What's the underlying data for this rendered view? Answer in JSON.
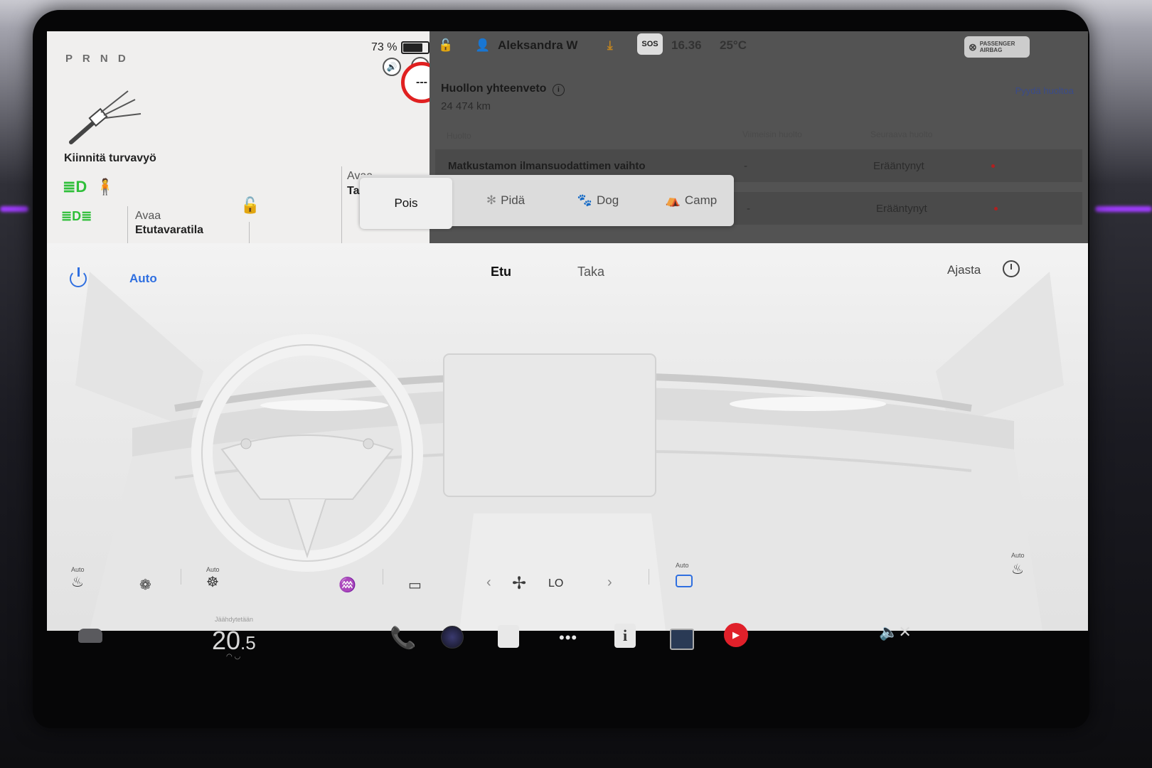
{
  "drive": {
    "gears": "P R N D",
    "battery_percent": "73 %",
    "battery_level": 0.73,
    "speed_limit": "---",
    "seatbelt_warning": "Kiinnitä turvavyö",
    "frunk": {
      "line1": "Avaa",
      "line2": "Etutavaratila"
    },
    "trunk": {
      "line1": "Avaa",
      "line2": "Ta"
    }
  },
  "status": {
    "user": "Aleksandra W",
    "sos": "SOS",
    "time": "16.36",
    "outside_temp": "25°C",
    "airbag": "PASSENGER AIRBAG"
  },
  "service": {
    "title": "Huollon yhteenveto",
    "odometer": "24 474 km",
    "link": "Pyydä huoltoa",
    "columns": [
      "Huolto",
      "Viimeisin huolto",
      "Seuraava huolto"
    ],
    "rows": [
      {
        "name": "Matkustamon ilmansuodattimen vaihto",
        "last": "-",
        "next": "Erääntynyt"
      },
      {
        "name": "",
        "last": "-",
        "next": "Erääntynyt"
      }
    ]
  },
  "modes": [
    {
      "label": "Pois",
      "active": true
    },
    {
      "label": "Pidä",
      "active": false
    },
    {
      "label": "Dog",
      "active": false
    },
    {
      "label": "Camp",
      "active": false
    }
  ],
  "climate": {
    "auto": "Auto",
    "tabs": [
      "Etu",
      "Taka"
    ],
    "schedule": "Ajasta",
    "auto_small": "Auto",
    "fan_speed": "LO"
  },
  "dock": {
    "cabin_status": "Jäähdytetään",
    "temp_whole": "20",
    "temp_fraction": ".5"
  },
  "colors": {
    "accent": "#2f6fe0",
    "warning": "#e02020",
    "green": "#2fbf3a"
  }
}
